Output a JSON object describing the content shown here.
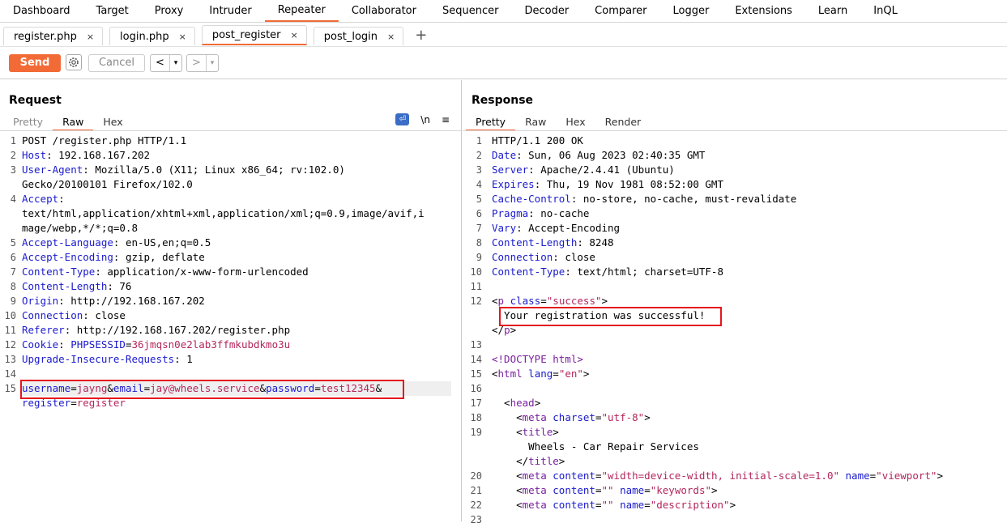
{
  "main_tabs": [
    "Dashboard",
    "Target",
    "Proxy",
    "Intruder",
    "Repeater",
    "Collaborator",
    "Sequencer",
    "Decoder",
    "Comparer",
    "Logger",
    "Extensions",
    "Learn",
    "InQL"
  ],
  "active_main_tab": "Repeater",
  "sub_tabs": [
    "register.php",
    "login.php",
    "post_register",
    "post_login"
  ],
  "active_sub_tab": "post_register",
  "toolbar": {
    "send": "Send",
    "cancel": "Cancel",
    "back": "<",
    "forward": ">",
    "dropdown": "▾"
  },
  "request": {
    "title": "Request",
    "view_tabs": [
      "Pretty",
      "Raw",
      "Hex"
    ],
    "active_view": "Raw",
    "tools": {
      "newline": "\\n",
      "menu": "≡"
    },
    "lines": [
      {
        "n": "1",
        "segs": [
          [
            "POST /register.php HTTP/1.1",
            "hv"
          ]
        ]
      },
      {
        "n": "2",
        "segs": [
          [
            "Host",
            "hk"
          ],
          [
            ": 192.168.167.202",
            "hv"
          ]
        ]
      },
      {
        "n": "3",
        "segs": [
          [
            "User-Agent",
            "hk"
          ],
          [
            ": Mozilla/5.0 (X11; Linux x86_64; rv:102.0)",
            "hv"
          ]
        ]
      },
      {
        "n": "",
        "segs": [
          [
            "Gecko/20100101 Firefox/102.0",
            "hv"
          ]
        ]
      },
      {
        "n": "4",
        "segs": [
          [
            "Accept",
            "hk"
          ],
          [
            ":",
            "hv"
          ]
        ]
      },
      {
        "n": "",
        "segs": [
          [
            "text/html,application/xhtml+xml,application/xml;q=0.9,image/avif,i",
            "hv"
          ]
        ]
      },
      {
        "n": "",
        "segs": [
          [
            "mage/webp,*/*;q=0.8",
            "hv"
          ]
        ]
      },
      {
        "n": "5",
        "segs": [
          [
            "Accept-Language",
            "hk"
          ],
          [
            ": en-US,en;q=0.5",
            "hv"
          ]
        ]
      },
      {
        "n": "6",
        "segs": [
          [
            "Accept-Encoding",
            "hk"
          ],
          [
            ": gzip, deflate",
            "hv"
          ]
        ]
      },
      {
        "n": "7",
        "segs": [
          [
            "Content-Type",
            "hk"
          ],
          [
            ": application/x-www-form-urlencoded",
            "hv"
          ]
        ]
      },
      {
        "n": "8",
        "segs": [
          [
            "Content-Length",
            "hk"
          ],
          [
            ": 76",
            "hv"
          ]
        ]
      },
      {
        "n": "9",
        "segs": [
          [
            "Origin",
            "hk"
          ],
          [
            ": http://192.168.167.202",
            "hv"
          ]
        ]
      },
      {
        "n": "10",
        "segs": [
          [
            "Connection",
            "hk"
          ],
          [
            ": close",
            "hv"
          ]
        ]
      },
      {
        "n": "11",
        "segs": [
          [
            "Referer",
            "hk"
          ],
          [
            ": http://192.168.167.202/register.php",
            "hv"
          ]
        ]
      },
      {
        "n": "12",
        "segs": [
          [
            "Cookie",
            "hk"
          ],
          [
            ": ",
            "hv"
          ],
          [
            "PHPSESSID",
            "hk"
          ],
          [
            "=",
            "hv"
          ],
          [
            "36jmqsn0e2lab3ffmkubdkmo3u",
            "cookie"
          ]
        ]
      },
      {
        "n": "13",
        "segs": [
          [
            "Upgrade-Insecure-Requests",
            "hk"
          ],
          [
            ": 1",
            "hv"
          ]
        ]
      },
      {
        "n": "14",
        "segs": []
      },
      {
        "n": "15",
        "segs": [
          [
            "username",
            "hk"
          ],
          [
            "=",
            "hv"
          ],
          [
            "jayng",
            "cookie"
          ],
          [
            "&",
            "hv"
          ],
          [
            "email",
            "hk"
          ],
          [
            "=",
            "hv"
          ],
          [
            "jay@wheels.service",
            "cookie"
          ],
          [
            "&",
            "hv"
          ],
          [
            "password",
            "hk"
          ],
          [
            "=",
            "hv"
          ],
          [
            "test12345",
            "cookie"
          ],
          [
            "&",
            "hv"
          ]
        ]
      },
      {
        "n": "",
        "segs": [
          [
            "register",
            "hk"
          ],
          [
            "=",
            "hv"
          ],
          [
            "register",
            "cookie"
          ]
        ]
      }
    ]
  },
  "response": {
    "title": "Response",
    "view_tabs": [
      "Pretty",
      "Raw",
      "Hex",
      "Render"
    ],
    "active_view": "Pretty",
    "lines": [
      {
        "n": "1",
        "segs": [
          [
            "HTTP/1.1 200 OK",
            "hv"
          ]
        ]
      },
      {
        "n": "2",
        "segs": [
          [
            "Date",
            "hk"
          ],
          [
            ": Sun, 06 Aug 2023 02:40:35 GMT",
            "hv"
          ]
        ]
      },
      {
        "n": "3",
        "segs": [
          [
            "Server",
            "hk"
          ],
          [
            ": Apache/2.4.41 (Ubuntu)",
            "hv"
          ]
        ]
      },
      {
        "n": "4",
        "segs": [
          [
            "Expires",
            "hk"
          ],
          [
            ": Thu, 19 Nov 1981 08:52:00 GMT",
            "hv"
          ]
        ]
      },
      {
        "n": "5",
        "segs": [
          [
            "Cache-Control",
            "hk"
          ],
          [
            ": no-store, no-cache, must-revalidate",
            "hv"
          ]
        ]
      },
      {
        "n": "6",
        "segs": [
          [
            "Pragma",
            "hk"
          ],
          [
            ": no-cache",
            "hv"
          ]
        ]
      },
      {
        "n": "7",
        "segs": [
          [
            "Vary",
            "hk"
          ],
          [
            ": Accept-Encoding",
            "hv"
          ]
        ]
      },
      {
        "n": "8",
        "segs": [
          [
            "Content-Length",
            "hk"
          ],
          [
            ": 8248",
            "hv"
          ]
        ]
      },
      {
        "n": "9",
        "segs": [
          [
            "Connection",
            "hk"
          ],
          [
            ": close",
            "hv"
          ]
        ]
      },
      {
        "n": "10",
        "segs": [
          [
            "Content-Type",
            "hk"
          ],
          [
            ": text/html; charset=UTF-8",
            "hv"
          ]
        ]
      },
      {
        "n": "11",
        "segs": []
      },
      {
        "n": "12",
        "segs": [
          [
            "<",
            "hv"
          ],
          [
            "p",
            "tag"
          ],
          [
            " ",
            "hv"
          ],
          [
            "class",
            "attr"
          ],
          [
            "=",
            "hv"
          ],
          [
            "\"success\"",
            "str"
          ],
          [
            ">",
            "hv"
          ]
        ]
      },
      {
        "n": "",
        "segs": [
          [
            "  Your registration was successful!",
            "hv"
          ]
        ]
      },
      {
        "n": "",
        "segs": [
          [
            "</",
            "hv"
          ],
          [
            "p",
            "tag"
          ],
          [
            ">",
            "hv"
          ]
        ]
      },
      {
        "n": "13",
        "segs": []
      },
      {
        "n": "14",
        "segs": [
          [
            "<!DOCTYPE html>",
            "tag"
          ]
        ]
      },
      {
        "n": "15",
        "segs": [
          [
            "<",
            "hv"
          ],
          [
            "html",
            "tag"
          ],
          [
            " ",
            "hv"
          ],
          [
            "lang",
            "attr"
          ],
          [
            "=",
            "hv"
          ],
          [
            "\"en\"",
            "str"
          ],
          [
            ">",
            "hv"
          ]
        ]
      },
      {
        "n": "16",
        "segs": []
      },
      {
        "n": "17",
        "segs": [
          [
            "  <",
            "hv"
          ],
          [
            "head",
            "tag"
          ],
          [
            ">",
            "hv"
          ]
        ]
      },
      {
        "n": "18",
        "segs": [
          [
            "    <",
            "hv"
          ],
          [
            "meta",
            "tag"
          ],
          [
            " ",
            "hv"
          ],
          [
            "charset",
            "attr"
          ],
          [
            "=",
            "hv"
          ],
          [
            "\"utf-8\"",
            "str"
          ],
          [
            ">",
            "hv"
          ]
        ]
      },
      {
        "n": "19",
        "segs": [
          [
            "    <",
            "hv"
          ],
          [
            "title",
            "tag"
          ],
          [
            ">",
            "hv"
          ]
        ]
      },
      {
        "n": "",
        "segs": [
          [
            "      Wheels - Car Repair Services",
            "hv"
          ]
        ]
      },
      {
        "n": "",
        "segs": [
          [
            "    </",
            "hv"
          ],
          [
            "title",
            "tag"
          ],
          [
            ">",
            "hv"
          ]
        ]
      },
      {
        "n": "20",
        "segs": [
          [
            "    <",
            "hv"
          ],
          [
            "meta",
            "tag"
          ],
          [
            " ",
            "hv"
          ],
          [
            "content",
            "attr"
          ],
          [
            "=",
            "hv"
          ],
          [
            "\"width=device-width, initial-scale=1.0\"",
            "str"
          ],
          [
            " ",
            "hv"
          ],
          [
            "name",
            "attr"
          ],
          [
            "=",
            "hv"
          ],
          [
            "\"viewport\"",
            "str"
          ],
          [
            ">",
            "hv"
          ]
        ]
      },
      {
        "n": "21",
        "segs": [
          [
            "    <",
            "hv"
          ],
          [
            "meta",
            "tag"
          ],
          [
            " ",
            "hv"
          ],
          [
            "content",
            "attr"
          ],
          [
            "=",
            "hv"
          ],
          [
            "\"\"",
            "str"
          ],
          [
            " ",
            "hv"
          ],
          [
            "name",
            "attr"
          ],
          [
            "=",
            "hv"
          ],
          [
            "\"keywords\"",
            "str"
          ],
          [
            ">",
            "hv"
          ]
        ]
      },
      {
        "n": "22",
        "segs": [
          [
            "    <",
            "hv"
          ],
          [
            "meta",
            "tag"
          ],
          [
            " ",
            "hv"
          ],
          [
            "content",
            "attr"
          ],
          [
            "=",
            "hv"
          ],
          [
            "\"\"",
            "str"
          ],
          [
            " ",
            "hv"
          ],
          [
            "name",
            "attr"
          ],
          [
            "=",
            "hv"
          ],
          [
            "\"description\"",
            "str"
          ],
          [
            ">",
            "hv"
          ]
        ]
      },
      {
        "n": "23",
        "segs": []
      }
    ]
  }
}
